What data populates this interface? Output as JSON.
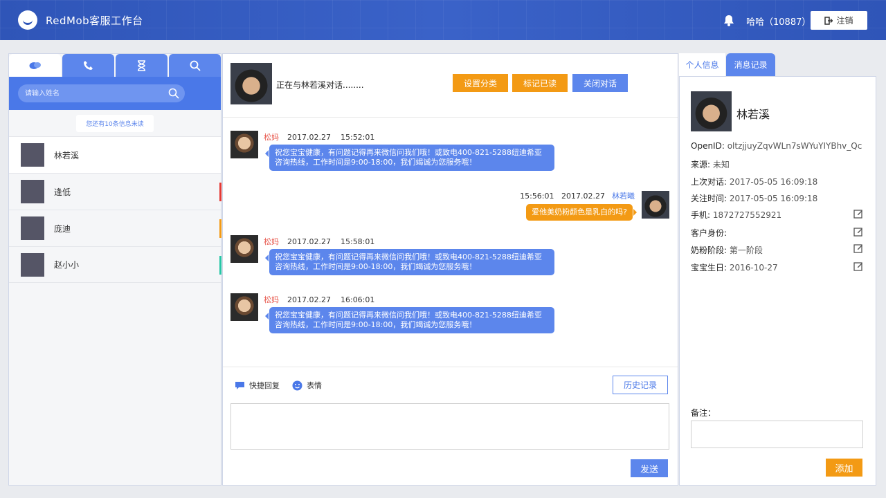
{
  "header": {
    "app_title": "RedMob客服工作台",
    "user": "哈哈（10887）",
    "logout_label": "注销"
  },
  "left": {
    "search_placeholder": "请输入姓名",
    "unread_notice": "您还有10条信息未读",
    "contacts": [
      {
        "name": "林若溪",
        "flag_color": ""
      },
      {
        "name": "逢低",
        "flag_color": "#e53935"
      },
      {
        "name": "庞迪",
        "flag_color": "#f39a14"
      },
      {
        "name": "赵小小",
        "flag_color": "#26c6a6"
      }
    ]
  },
  "chat": {
    "status": "正在与林若溪对话........",
    "buttons": {
      "category": "设置分类",
      "mark_read": "标记已读",
      "close": "关闭对话"
    },
    "messages": [
      {
        "sender": "松妈",
        "date": "2017.02.27",
        "time": "15:52:01",
        "text": "祝您宝宝健康，有问题记得再来微信问我们哦！或致电400-821-5288纽迪希亚咨询热线，工作时间是9:00-18:00，我们竭诚为您服务哦！"
      },
      {
        "sender": "林若曦",
        "date": "2017.02.27",
        "time": "15:56:01",
        "text": "爱他美奶粉颜色是乳白的吗?"
      },
      {
        "sender": "松妈",
        "date": "2017.02.27",
        "time": "15:58:01",
        "text": "祝您宝宝健康，有问题记得再来微信问我们哦！或致电400-821-5288纽迪希亚咨询热线，工作时间是9:00-18:00，我们竭诚为您服务哦！"
      },
      {
        "sender": "松妈",
        "date": "2017.02.27",
        "time": "16:06:01",
        "text": "祝您宝宝健康，有问题记得再来微信问我们哦！或致电400-821-5288纽迪希亚咨询热线，工作时间是9:00-18:00，我们竭诚为您服务哦！"
      }
    ],
    "quick_reply": "快捷回复",
    "emoji": "表情",
    "history": "历史记录",
    "send": "发送"
  },
  "right": {
    "tabs": [
      "个人信息",
      "消息记录"
    ],
    "name": "林若溪",
    "fields": [
      {
        "label": "OpenID: ",
        "value": "oltzjjuyZqvWLn7sWYuYIYBhv_Qc"
      },
      {
        "label": "来源: ",
        "value": "未知"
      },
      {
        "label": "上次对话: ",
        "value": "2017-05-05  16:09:18"
      },
      {
        "label": "关注时间: ",
        "value": "2017-05-05  16:09:18"
      },
      {
        "label": "手机: ",
        "value": "1872727552921"
      },
      {
        "label": "客户身份:",
        "value": ""
      },
      {
        "label": "奶粉阶段: ",
        "value": "第一阶段"
      },
      {
        "label": "宝宝生日: ",
        "value": "2016-10-27"
      }
    ],
    "remark_label": "备注：",
    "add": "添加"
  },
  "colors": {
    "primary": "#4a78e8",
    "accent": "#f39a14",
    "header": "#2f55b8"
  }
}
